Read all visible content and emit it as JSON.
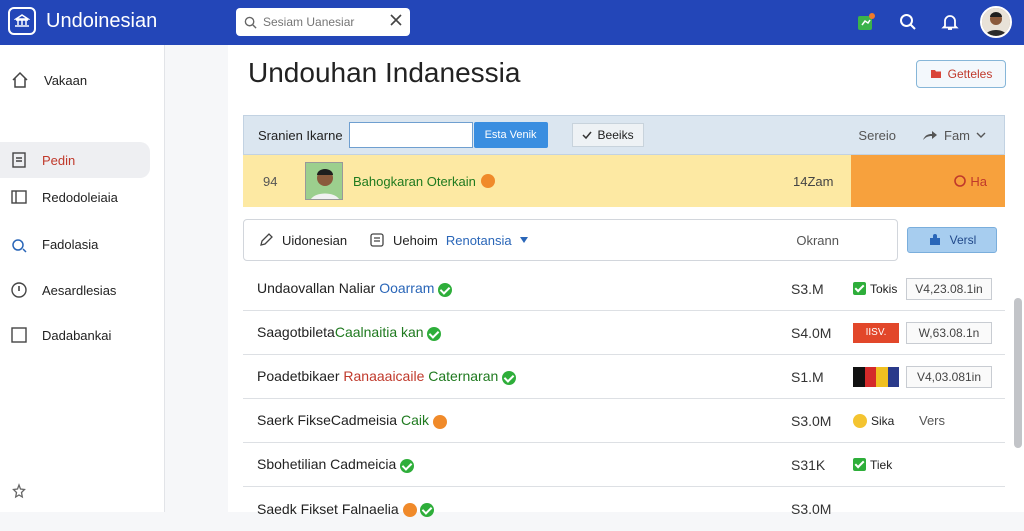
{
  "header": {
    "app_name": "Undoinesian",
    "search_placeholder": "Sesiam Uanesiar",
    "icons": [
      "brand-logo-icon",
      "search-icon",
      "clear-icon",
      "notification-icon",
      "search-icon",
      "bell-icon",
      "avatar"
    ]
  },
  "sidebar": {
    "items": [
      {
        "label": "Vakaan",
        "icon": "home-icon"
      },
      {
        "label": "Pedin",
        "icon": "document-icon",
        "active": true
      },
      {
        "label": "Redodoleiaia",
        "icon": "panel-icon"
      },
      {
        "label": "Fadolasia",
        "icon": "chart-icon"
      },
      {
        "label": "Aesardlesias",
        "icon": "pin-icon"
      },
      {
        "label": "Dadabankai",
        "icon": "square-icon"
      }
    ]
  },
  "main": {
    "title": "Undouhan Indanessia",
    "primary_button": "Getteles",
    "filter": {
      "label": "Sranien Ikarne",
      "input_value": "",
      "go_label": "Esta Venik",
      "sort_label": "Beeiks",
      "col_right_1": "Sereio",
      "col_right_2": "Fam"
    },
    "highlight": {
      "number": "94",
      "name": "Bahogkaran Oterkain",
      "size": "14Zam",
      "status": "Ha"
    },
    "lang_row": {
      "item1": "Uidonesian",
      "item2_prefix": "Uehoim",
      "item2_link": "Renotansia",
      "right": "Okrann",
      "view_button": "Versl"
    },
    "rows": [
      {
        "name": "Undaovallan Naliar",
        "name_accent": "Ooarram",
        "size": "S3.M",
        "tag": "Tokis",
        "stamp": "V4,23.08.1in"
      },
      {
        "name": "Saagotbileta",
        "name_accent": "Caalnaitia kan",
        "size": "S4.0M",
        "badge": "IISV.",
        "stamp": "W,63.08.1n"
      },
      {
        "name": "Poadetbikaer",
        "name_accent": "Ranaaaicaile",
        "name_tail": "Caternaran",
        "size": "S1.M",
        "stamp": "V4,03.081in"
      },
      {
        "name": "Saerk FikseCadmeisia",
        "name_accent": "Caik",
        "size": "S3.0M",
        "tag": "Sika",
        "plain": "Vers"
      },
      {
        "name": "Sbohetilian Cadmeicia",
        "size": "S31K",
        "tag": "Tiek"
      },
      {
        "name": "Saedk Fikset Falnaelia",
        "size": "S3.0M"
      }
    ]
  },
  "colors": {
    "header_bg": "#2346b8",
    "highlight_bg": "#fde9a3",
    "highlight_accent": "#f7a13d",
    "active_text": "#c0392b",
    "check": "#2eae3a"
  }
}
